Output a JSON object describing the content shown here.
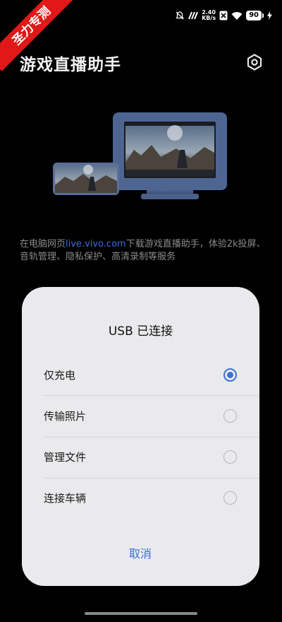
{
  "status_bar": {
    "net_speed_value": "2.40",
    "net_speed_unit": "KB/s",
    "battery": "90"
  },
  "watermark": "圣力专测",
  "header": {
    "title": "游戏直播助手"
  },
  "description": {
    "prefix": "在电脑网页",
    "link": "live.vivo.com",
    "suffix": "下载游戏直播助手，体验2k投屏、音轨管理、隐私保护、高清录制等服务"
  },
  "dialog": {
    "title": "USB 已连接",
    "options": [
      {
        "label": "仅充电",
        "selected": true
      },
      {
        "label": "传输照片",
        "selected": false
      },
      {
        "label": "管理文件",
        "selected": false
      },
      {
        "label": "连接车辆",
        "selected": false
      }
    ],
    "cancel_label": "取消"
  },
  "colors": {
    "accent": "#3d6fd6",
    "watermark_red": "#e01818",
    "dialog_bg": "#eaeaec"
  }
}
